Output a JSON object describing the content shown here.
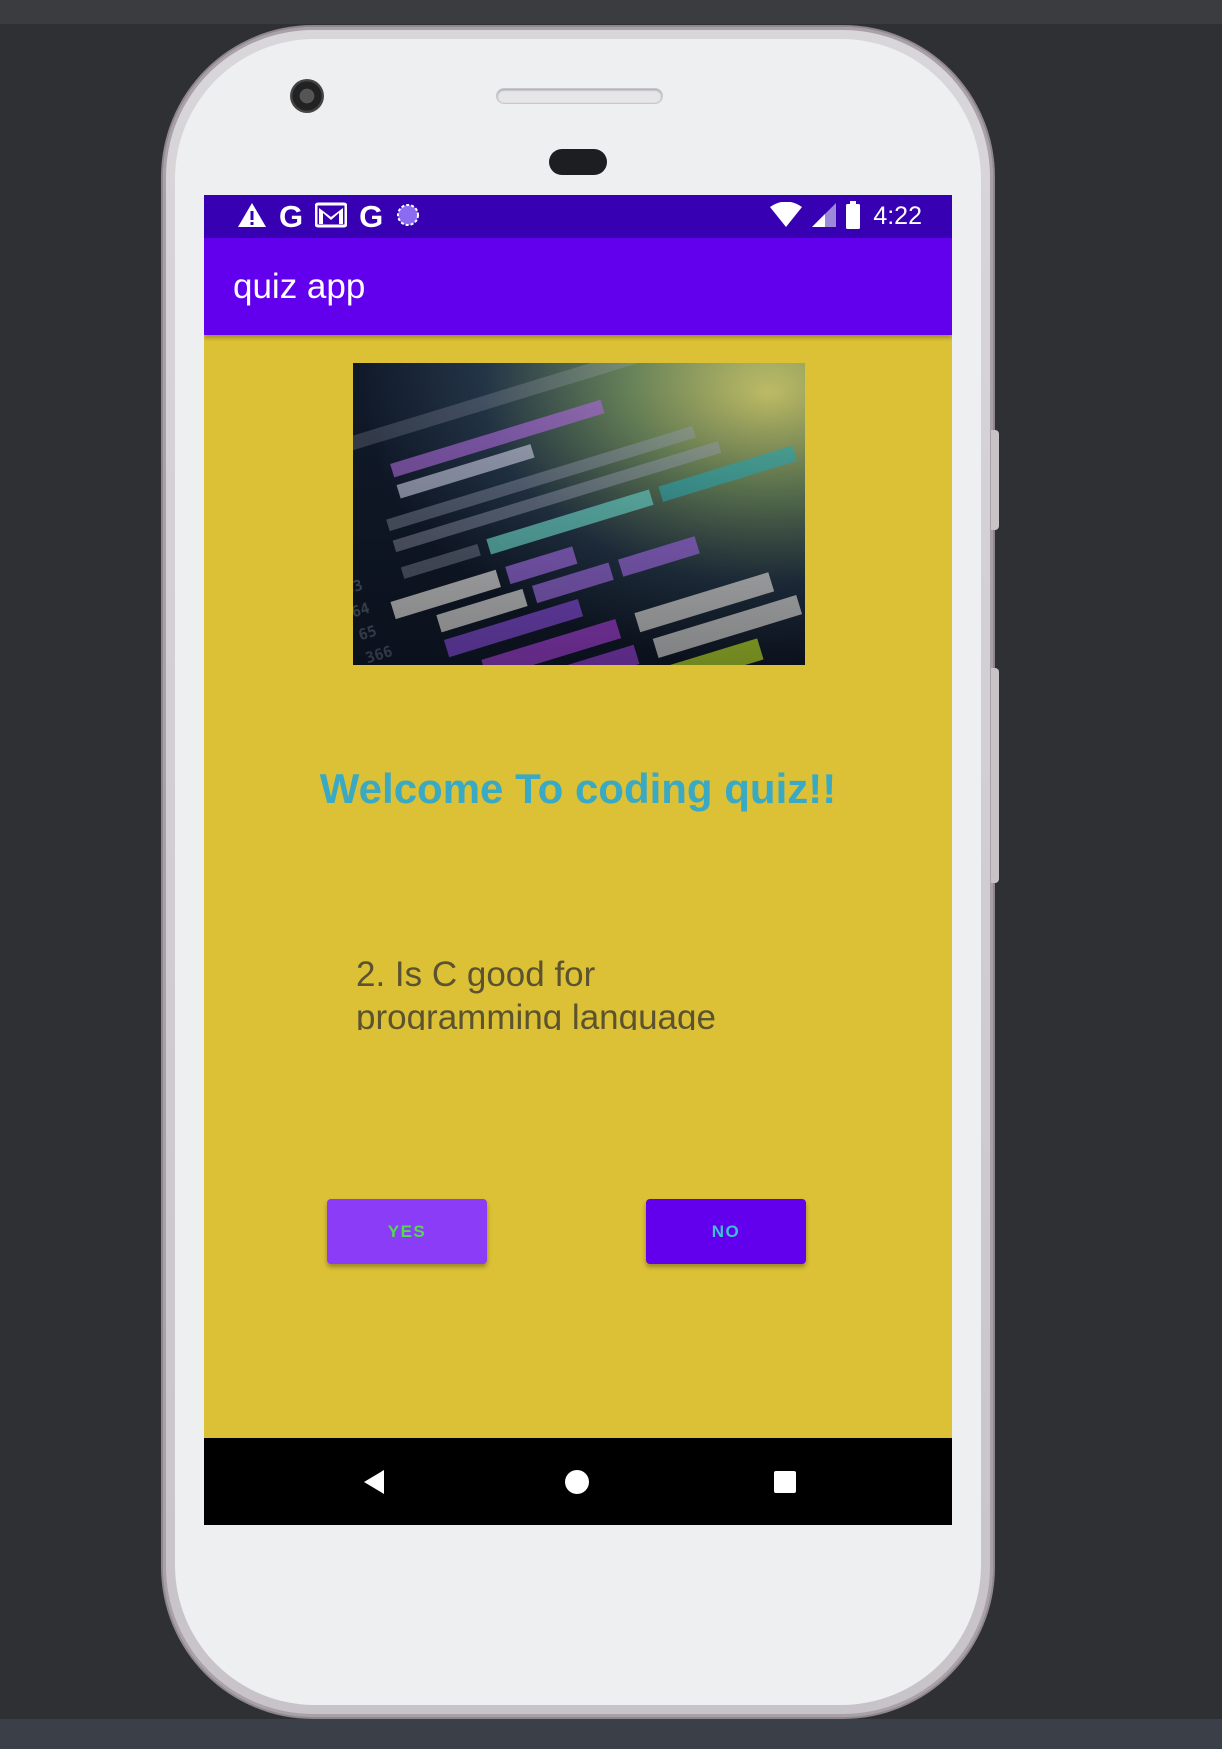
{
  "status_bar": {
    "left_icons": [
      "warning-icon",
      "google-g-icon",
      "gmail-icon",
      "google-g-icon",
      "sync-progress-icon"
    ],
    "right_icons": [
      "wifi-icon",
      "cell-signal-icon",
      "battery-icon"
    ],
    "time": "4:22"
  },
  "app_bar": {
    "title": "quiz app"
  },
  "banner": {
    "icon": "code-screen-image"
  },
  "welcome": {
    "text": "Welcome To coding quiz!!"
  },
  "question": {
    "text": "2. Is C good for programming language"
  },
  "buttons": {
    "yes_label": "YES",
    "no_label": "NO"
  },
  "nav_bar": {
    "icons": [
      "back-icon",
      "home-icon",
      "recents-icon"
    ]
  },
  "colors": {
    "screen_background": "#dcc036",
    "status_bar": "#3700b3",
    "app_bar": "#6200ee",
    "welcome_text": "#39a9c4",
    "yes_button": "#8b3cf6",
    "yes_text": "#54d84c",
    "no_button": "#6200ee",
    "no_text": "#3ec0d6"
  }
}
